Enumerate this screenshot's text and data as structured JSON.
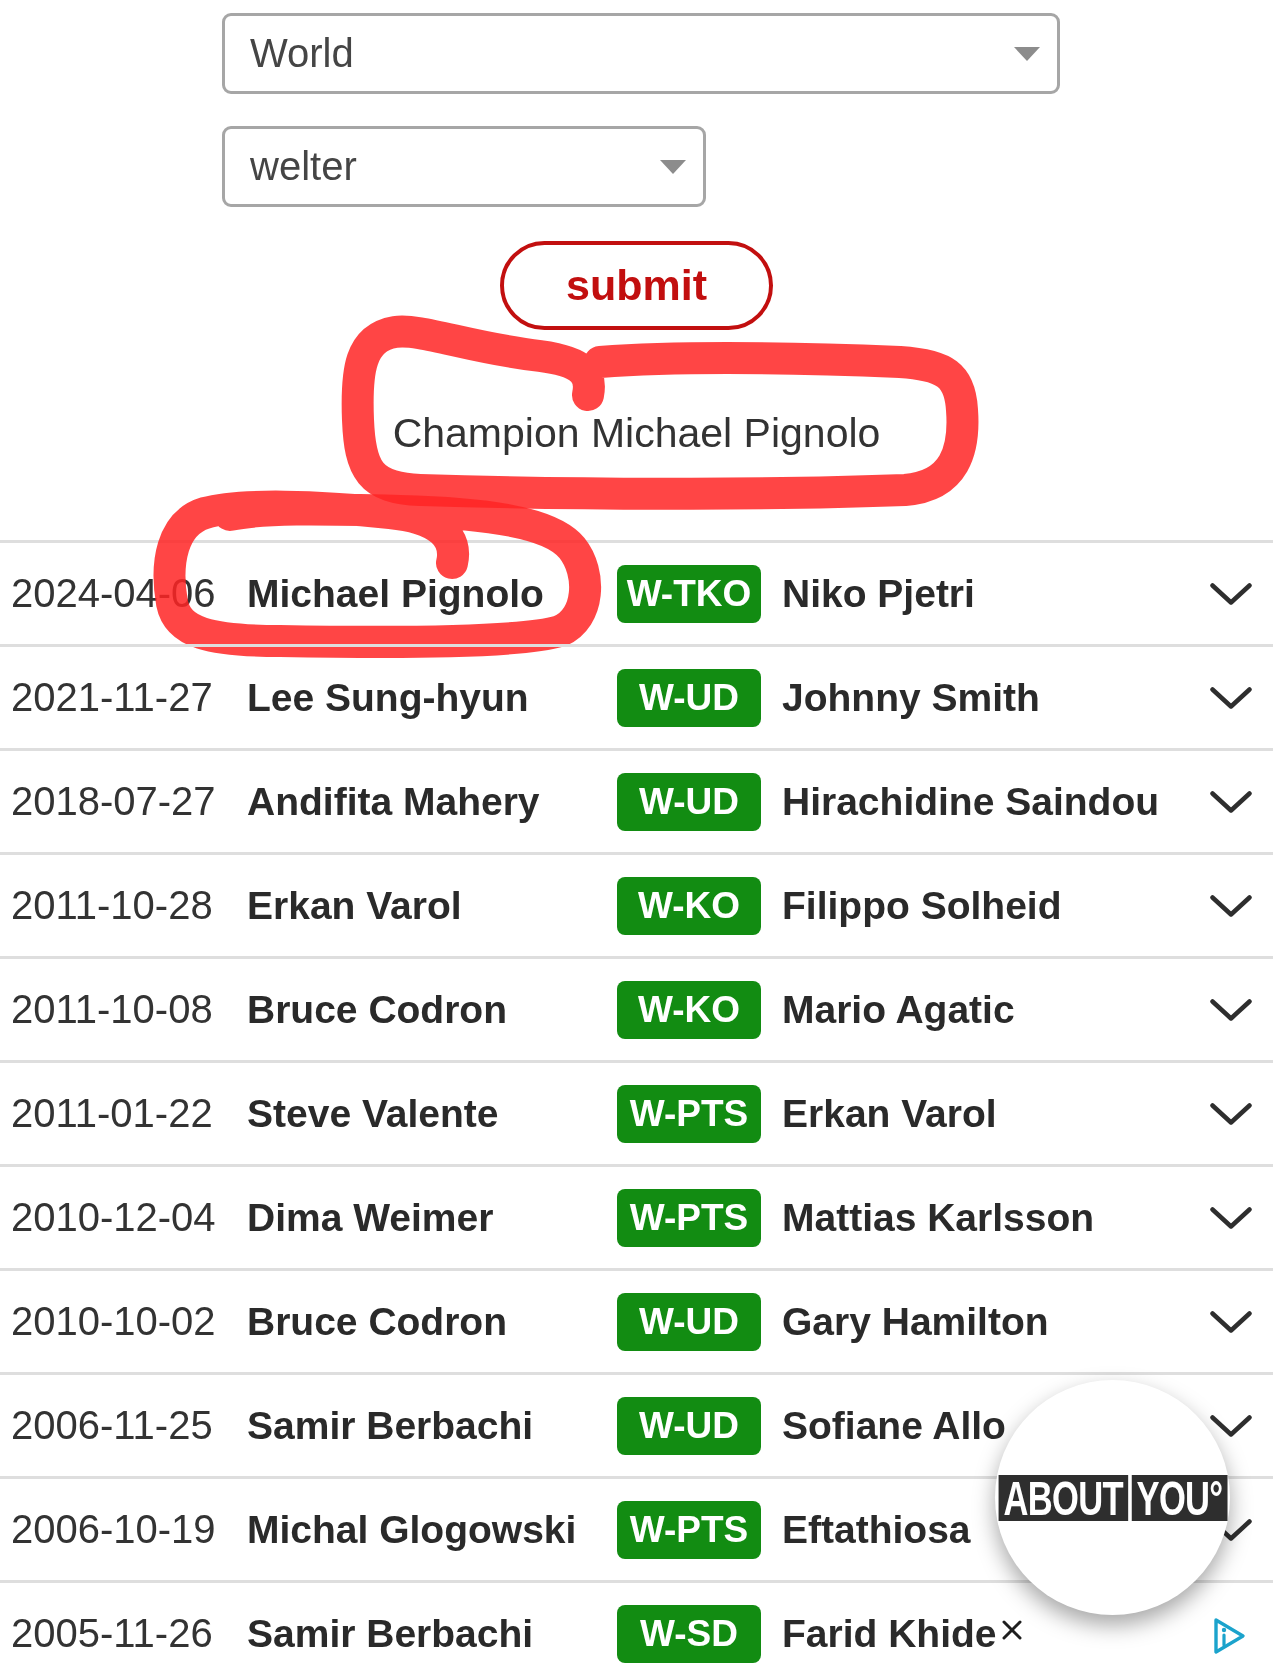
{
  "filters": [
    {
      "value": "World"
    },
    {
      "value": "welter"
    }
  ],
  "submit": {
    "label": "submit"
  },
  "champion": {
    "text": "Champion Michael Pignolo",
    "circled": true
  },
  "rows": [
    {
      "date": "2024-04-06",
      "winner": "Michael Pignolo",
      "result": "W-TKO",
      "opponent": "Niko Pjetri",
      "circled": true,
      "chevron": true
    },
    {
      "date": "2021-11-27",
      "winner": "Lee Sung-hyun",
      "result": "W-UD",
      "opponent": "Johnny Smith",
      "circled": false,
      "chevron": true
    },
    {
      "date": "2018-07-27",
      "winner": "Andifita Mahery",
      "result": "W-UD",
      "opponent": "Hirachidine Saindou",
      "circled": false,
      "chevron": true
    },
    {
      "date": "2011-10-28",
      "winner": "Erkan Varol",
      "result": "W-KO",
      "opponent": "Filippo Solheid",
      "circled": false,
      "chevron": true
    },
    {
      "date": "2011-10-08",
      "winner": "Bruce Codron",
      "result": "W-KO",
      "opponent": "Mario Agatic",
      "circled": false,
      "chevron": true
    },
    {
      "date": "2011-01-22",
      "winner": "Steve Valente",
      "result": "W-PTS",
      "opponent": "Erkan Varol",
      "circled": false,
      "chevron": true
    },
    {
      "date": "2010-12-04",
      "winner": "Dima Weimer",
      "result": "W-PTS",
      "opponent": "Mattias Karlsson",
      "circled": false,
      "chevron": true
    },
    {
      "date": "2010-10-02",
      "winner": "Bruce Codron",
      "result": "W-UD",
      "opponent": "Gary Hamilton",
      "circled": false,
      "chevron": true
    },
    {
      "date": "2006-11-25",
      "winner": "Samir Berbachi",
      "result": "W-UD",
      "opponent": "Sofiane Allo",
      "circled": false,
      "chevron": true
    },
    {
      "date": "2006-10-19",
      "winner": "Michal Glogowski",
      "result": "W-PTS",
      "opponent": "Eftathiosa",
      "circled": false,
      "chevron": true
    },
    {
      "date": "2005-11-26",
      "winner": "Samir Berbachi",
      "result": "W-SD",
      "opponent": "Farid Khide",
      "circled": false,
      "chevron": false
    }
  ],
  "ad": {
    "logo": [
      "ABOUT",
      "YOU°"
    ]
  }
}
